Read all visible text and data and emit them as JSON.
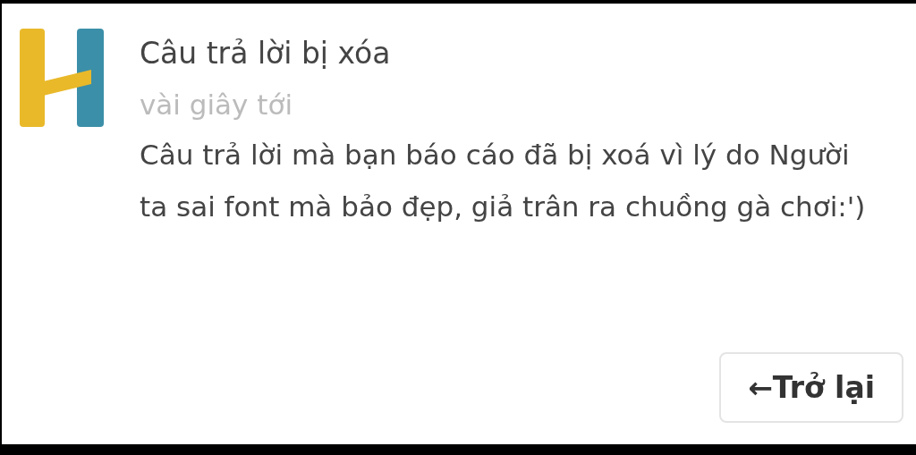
{
  "notification": {
    "title": "Câu trả lời bị xóa",
    "time": "vài giây tới",
    "message": "Câu trả lời mà bạn báo cáo đã bị xoá vì lý do Người ta sai font mà bảo đẹp, giả trân ra chuồng gà chơi:')"
  },
  "buttons": [
    {
      "label": "←Trở lại"
    }
  ]
}
